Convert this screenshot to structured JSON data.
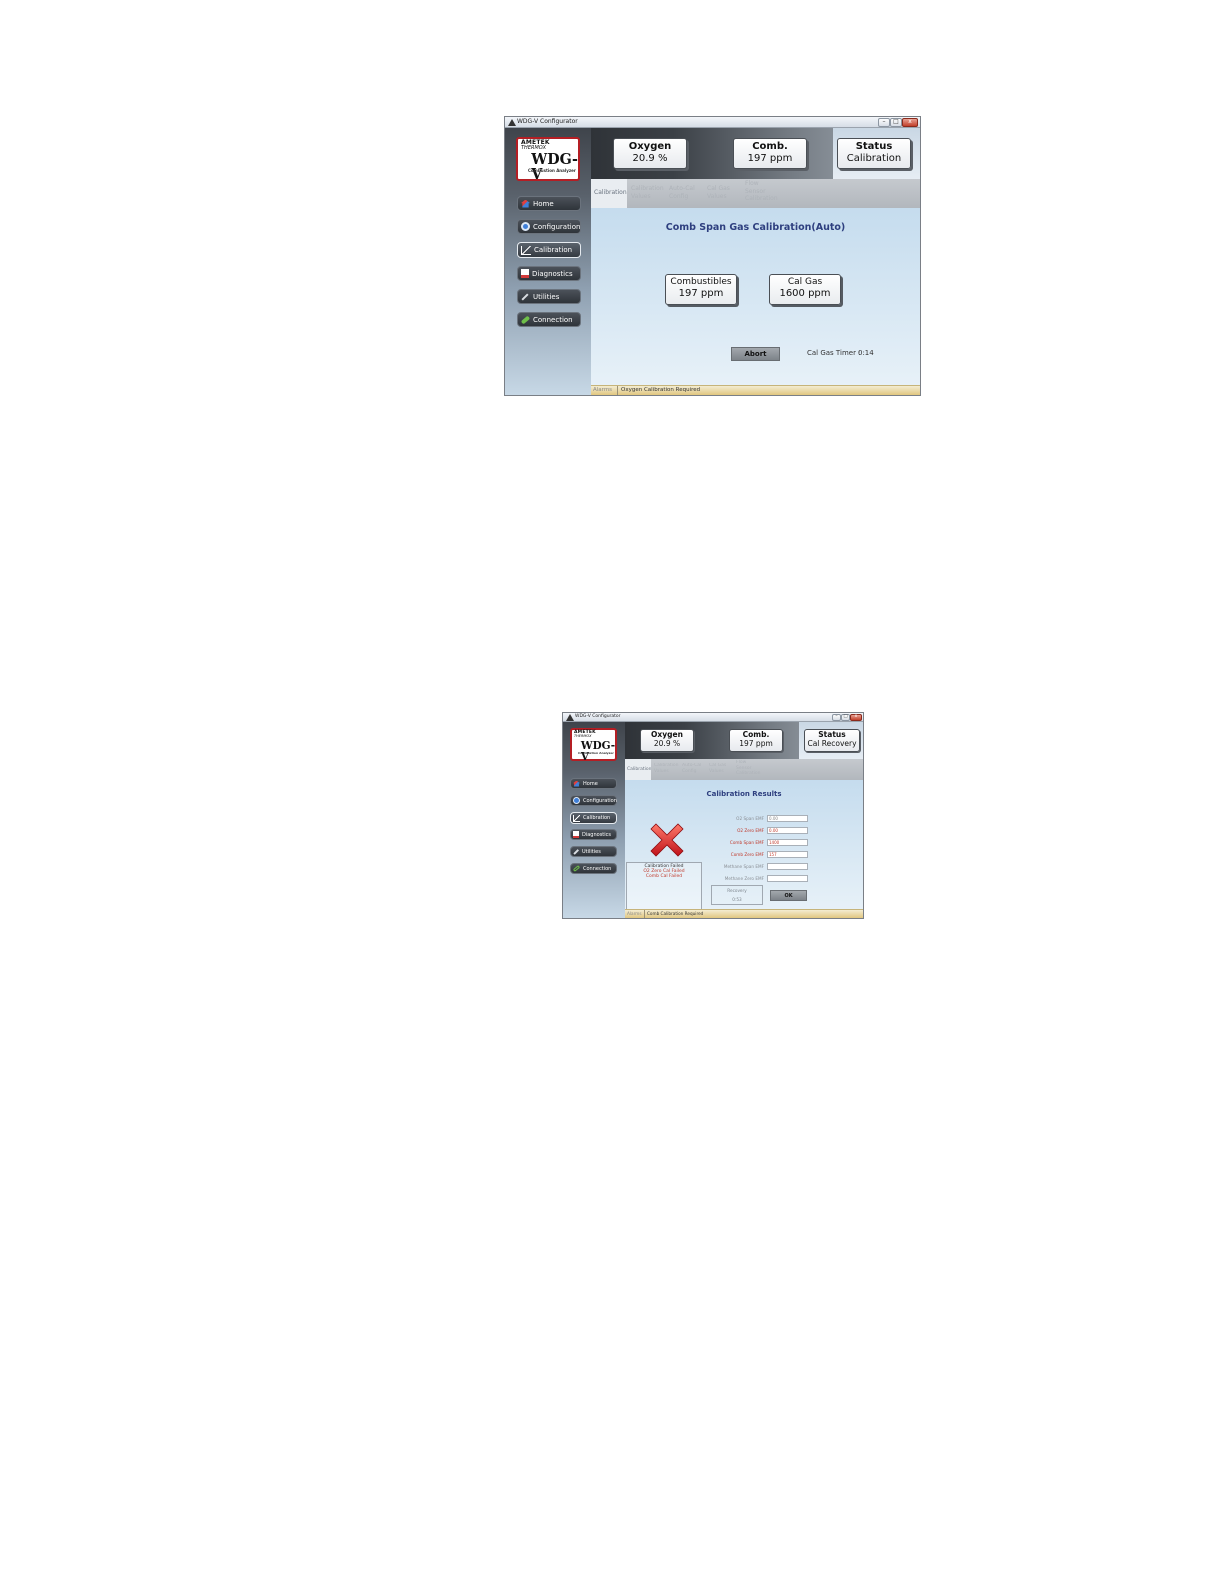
{
  "screen1": {
    "window_title": "WDG-V Configurator",
    "title_buttons": [
      "–",
      "□",
      "x"
    ],
    "logo": {
      "brand": "AMETEK",
      "sub": "THERMOX",
      "product": "WDG-V",
      "tagline": "Combustion Analyzer"
    },
    "nav": [
      {
        "label": "Home",
        "icon": "home-icon",
        "active": false
      },
      {
        "label": "Configuration",
        "icon": "gear-icon",
        "active": false
      },
      {
        "label": "Calibration",
        "icon": "calibration-icon",
        "active": true
      },
      {
        "label": "Diagnostics",
        "icon": "document-icon",
        "active": false
      },
      {
        "label": "Utilities",
        "icon": "wrench-icon",
        "active": false
      },
      {
        "label": "Connection",
        "icon": "link-icon",
        "active": false
      }
    ],
    "readouts": [
      {
        "label": "Oxygen",
        "value": "20.9 %"
      },
      {
        "label": "Comb.",
        "value": "197 ppm"
      },
      {
        "label": "Status",
        "value": "Calibration"
      }
    ],
    "tabs": [
      {
        "label": "Calibration",
        "active": true
      },
      {
        "label": "Calibration Values",
        "active": false
      },
      {
        "label": "Auto-Cal Config",
        "active": false
      },
      {
        "label": "Cal Gas Values",
        "active": false
      },
      {
        "label": "Flow Sensor Calibration",
        "active": false
      }
    ],
    "panel_title": "Comb Span Gas Calibration(Auto)",
    "values": [
      {
        "label": "Combustibles",
        "value": "197 ppm"
      },
      {
        "label": "Cal Gas",
        "value": "1600 ppm"
      }
    ],
    "abort_label": "Abort",
    "timer_label": "Cal Gas Timer :",
    "timer_value": "0:14",
    "status_area": "Alarms",
    "status_message": "Oxygen Calibration Required"
  },
  "screen2": {
    "window_title": "WDG-V Configurator",
    "title_buttons": [
      "–",
      "□",
      "x"
    ],
    "logo": {
      "brand": "AMETEK",
      "sub": "THERMOX",
      "product": "WDG-V",
      "tagline": "Combustion Analyzer"
    },
    "nav": [
      {
        "label": "Home",
        "icon": "home-icon",
        "active": false
      },
      {
        "label": "Configuration",
        "icon": "gear-icon",
        "active": false
      },
      {
        "label": "Calibration",
        "icon": "calibration-icon",
        "active": true
      },
      {
        "label": "Diagnostics",
        "icon": "document-icon",
        "active": false
      },
      {
        "label": "Utilities",
        "icon": "wrench-icon",
        "active": false
      },
      {
        "label": "Connection",
        "icon": "link-icon",
        "active": false
      }
    ],
    "readouts": [
      {
        "label": "Oxygen",
        "value": "20.9 %"
      },
      {
        "label": "Comb.",
        "value": "197 ppm"
      },
      {
        "label": "Status",
        "value": "Cal Recovery"
      }
    ],
    "tabs": [
      {
        "label": "Calibration",
        "active": true
      },
      {
        "label": "Calibration Values",
        "active": false
      },
      {
        "label": "Auto-Cal Config",
        "active": false
      },
      {
        "label": "Cal Gas Values",
        "active": false
      },
      {
        "label": "Flow Sensor Calibration",
        "active": false
      }
    ],
    "panel_title": "Calibration Results",
    "fail_icon": "error-x-icon",
    "fail_title": "Calibration Failed",
    "fail_lines": [
      "O2 Zero Cal Failed",
      "Comb Cal Failed"
    ],
    "result_fields": [
      {
        "label": "O2 Span EMF",
        "value": "0.00",
        "red": false
      },
      {
        "label": "O2 Zero EMF",
        "value": "0.00",
        "red": true
      },
      {
        "label": "Comb Span EMF",
        "value": "1400",
        "red": true
      },
      {
        "label": "Comb Zero EMF",
        "value": "157",
        "red": true
      },
      {
        "label": "Methane Span EMF",
        "value": "",
        "red": false
      },
      {
        "label": "Methane Zero EMF",
        "value": "",
        "red": false
      }
    ],
    "recovery_label": "Recovery",
    "recovery_value": "0:53",
    "ok_label": "OK",
    "status_area": "Alarms",
    "status_message": "Comb Calibration Required"
  }
}
